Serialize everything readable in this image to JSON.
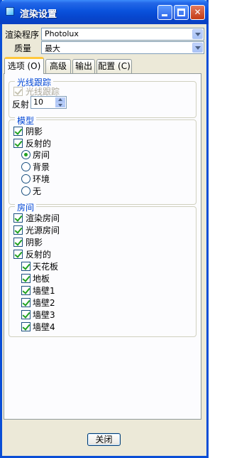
{
  "window": {
    "title": "渲染设置"
  },
  "form": {
    "program_label": "渲染程序",
    "program_value": "Photolux",
    "quality_label": "质量",
    "quality_value": "最大"
  },
  "tabs": [
    {
      "label": "选项 (O)",
      "active": true
    },
    {
      "label": "高级",
      "active": false
    },
    {
      "label": "输出",
      "active": false
    },
    {
      "label": "配置 (C)",
      "active": false
    }
  ],
  "raytrace": {
    "title": "光线跟踪",
    "checkbox_label": "光线跟踪",
    "checkbox_checked": true,
    "reflect_label": "反射",
    "reflect_value": "10"
  },
  "model": {
    "title": "模型",
    "shadow_label": "阴影",
    "reflective_label": "反射的",
    "radios": [
      {
        "label": "房间",
        "selected": true
      },
      {
        "label": "背景",
        "selected": false
      },
      {
        "label": "环境",
        "selected": false
      },
      {
        "label": "无",
        "selected": false
      }
    ]
  },
  "room": {
    "title": "房间",
    "items": [
      {
        "label": "渲染房间",
        "checked": true
      },
      {
        "label": "光源房间",
        "checked": true
      },
      {
        "label": "阴影",
        "checked": true
      },
      {
        "label": "反射的",
        "checked": true
      }
    ],
    "sub_items": [
      {
        "label": "天花板",
        "checked": true
      },
      {
        "label": "地板",
        "checked": true
      },
      {
        "label": "墙壁1",
        "checked": true
      },
      {
        "label": "墙壁2",
        "checked": true
      },
      {
        "label": "墙壁3",
        "checked": true
      },
      {
        "label": "墙壁4",
        "checked": true
      }
    ]
  },
  "footer": {
    "close_label": "关闭"
  },
  "colors": {
    "titlebar": "#0a52dc",
    "face": "#ece9d8",
    "group_title": "#0046d5",
    "check": "#21a121"
  }
}
